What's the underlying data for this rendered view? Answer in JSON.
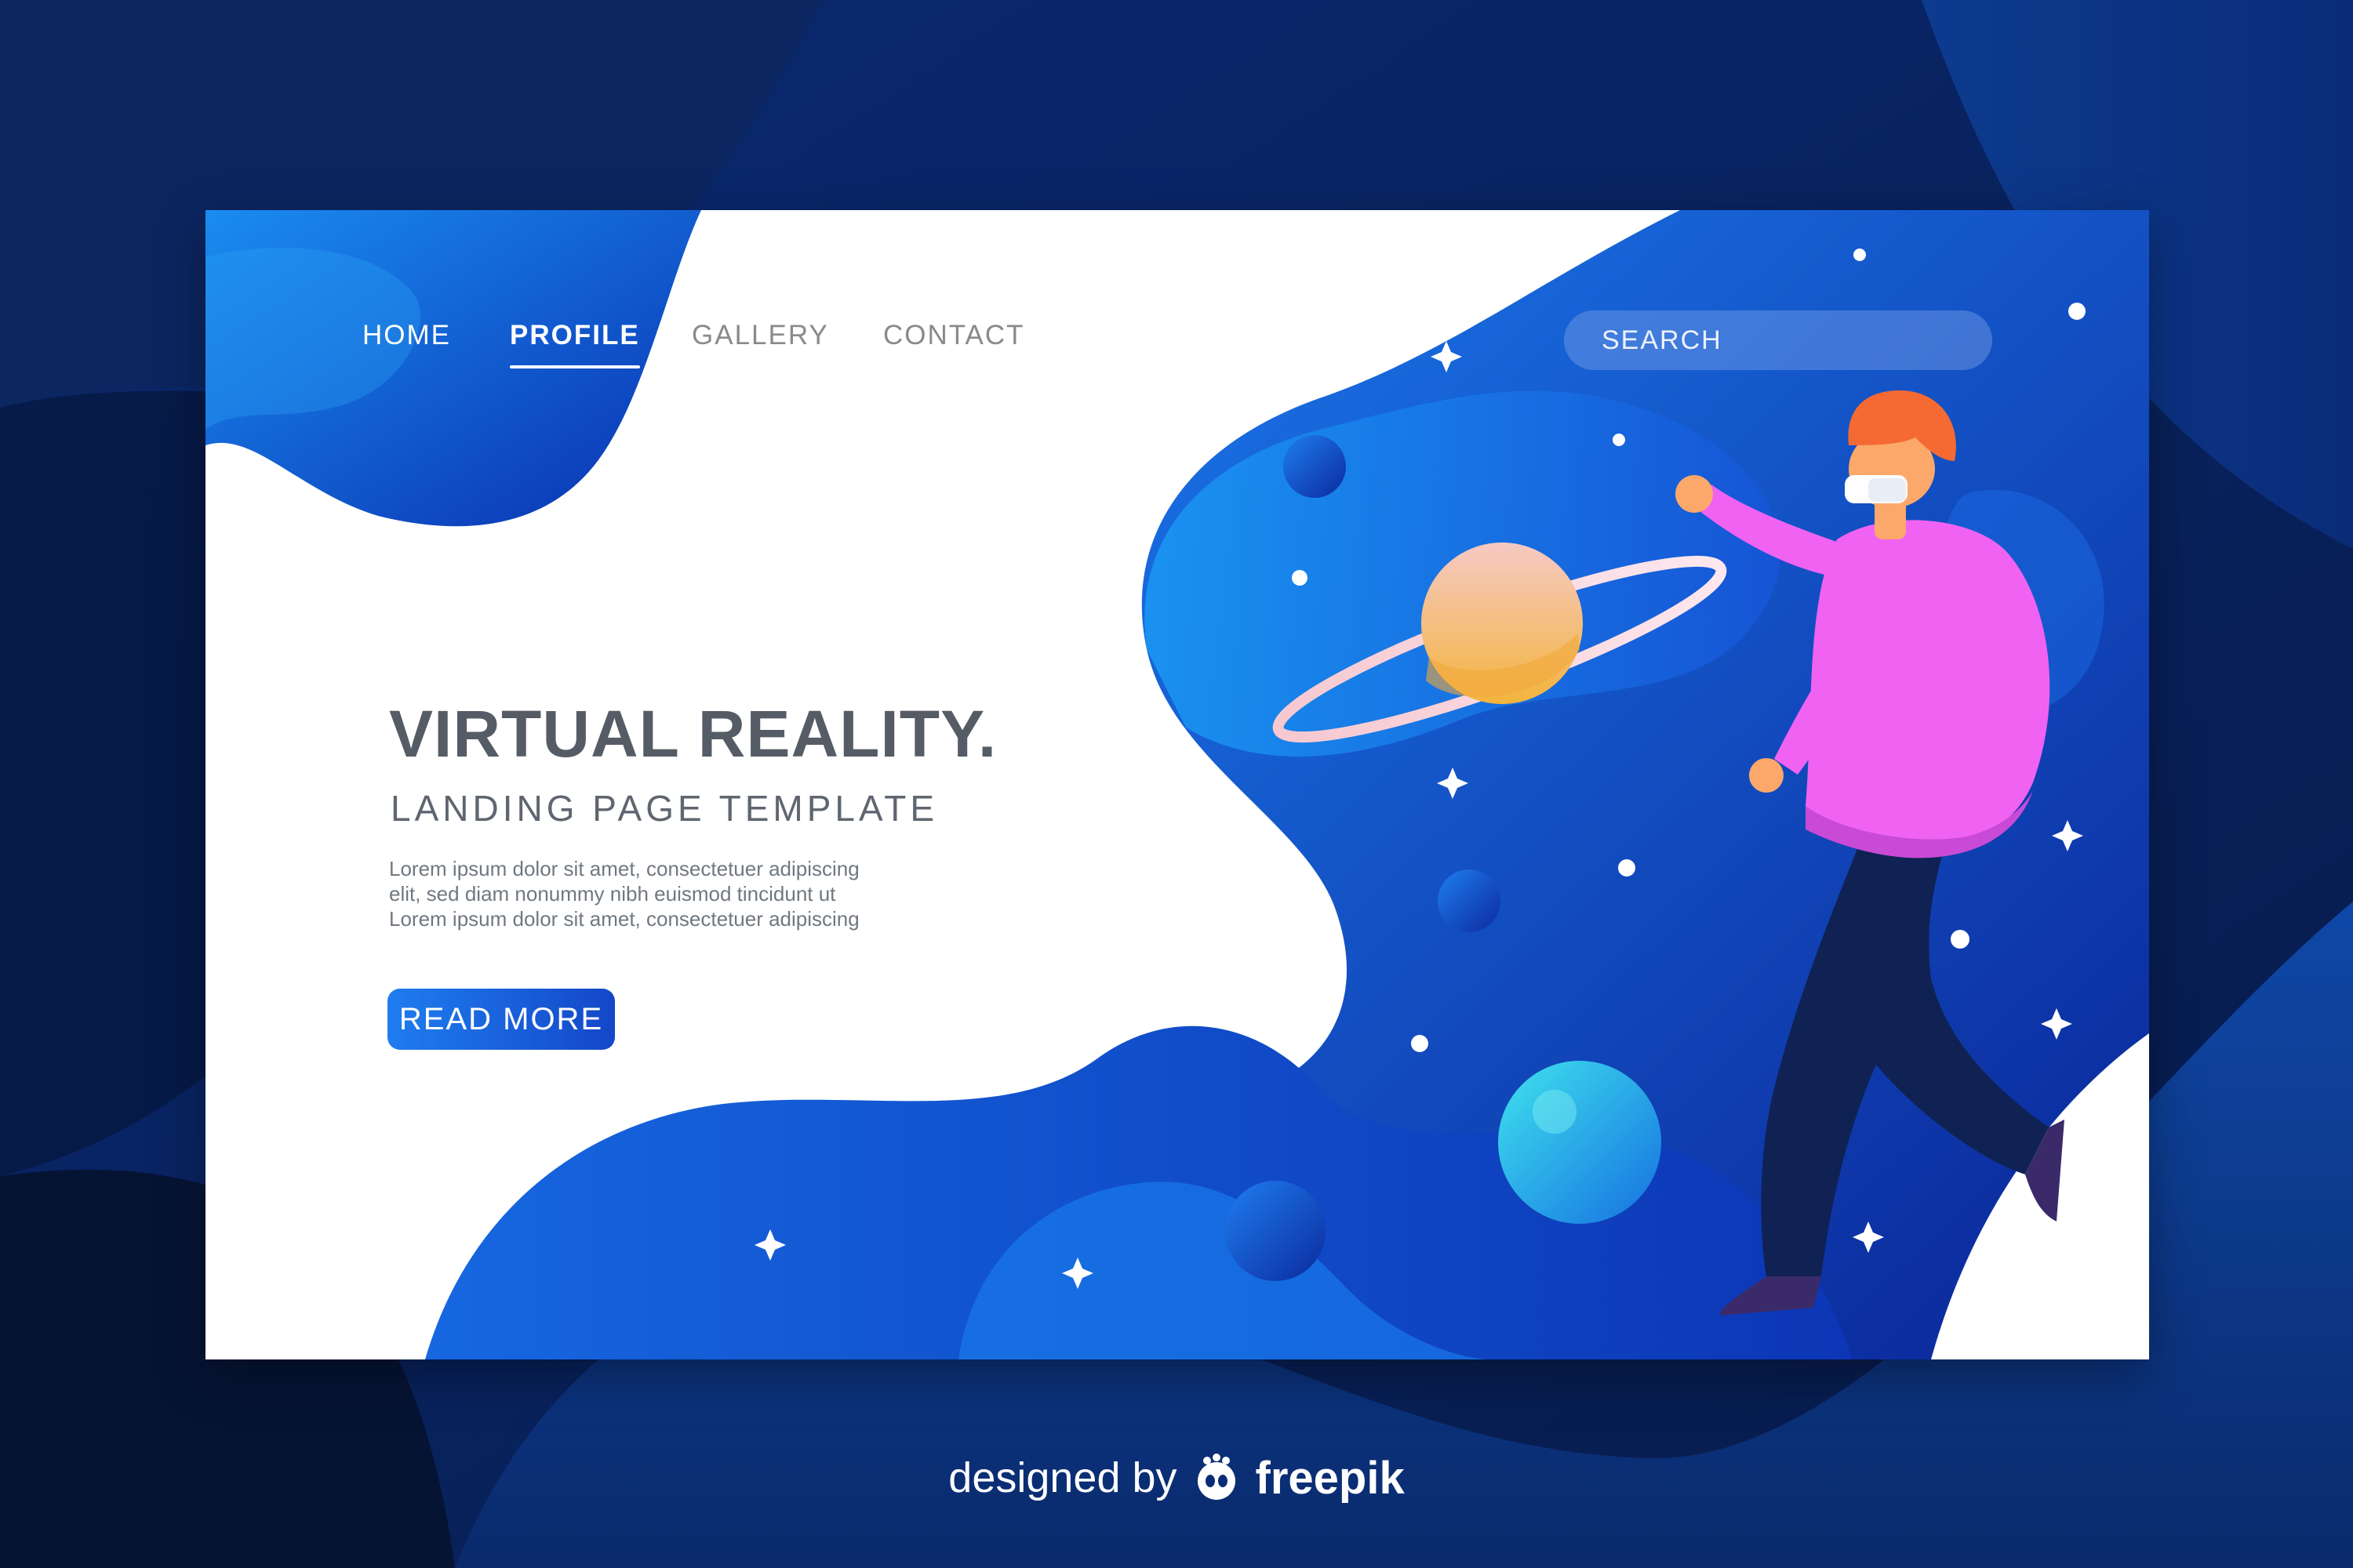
{
  "colors": {
    "background_dark": "#06122e",
    "blue_primary": "#1565e0",
    "blue_deep": "#0b2a9a",
    "card_white": "#ffffff",
    "shirt_pink": "#f063f2",
    "hair_orange": "#f46a32",
    "text_gray": "#555c66"
  },
  "nav": {
    "items": [
      {
        "label": "HOME"
      },
      {
        "label": "PROFILE",
        "active": true
      },
      {
        "label": "GALLERY"
      },
      {
        "label": "CONTACT"
      }
    ],
    "search_placeholder": "SEARCH"
  },
  "hero": {
    "title": "VIRTUAL REALITY.",
    "subtitle": "LANDING PAGE TEMPLATE",
    "body_lines": [
      "Lorem ipsum dolor sit amet, consectetuer adipiscing",
      "elit, sed diam nonummy nibh euismod tincidunt ut",
      "Lorem ipsum dolor sit amet, consectetuer adipiscing"
    ],
    "button_label": "READ MORE"
  },
  "credit": {
    "text": "designed by",
    "brand": "freepik"
  },
  "illustration": {
    "subject": "person wearing VR headset reaching toward ringed planet",
    "icons": [
      "vr-headset-icon",
      "ringed-planet-icon",
      "star-icon",
      "freepik-logo-icon"
    ]
  }
}
